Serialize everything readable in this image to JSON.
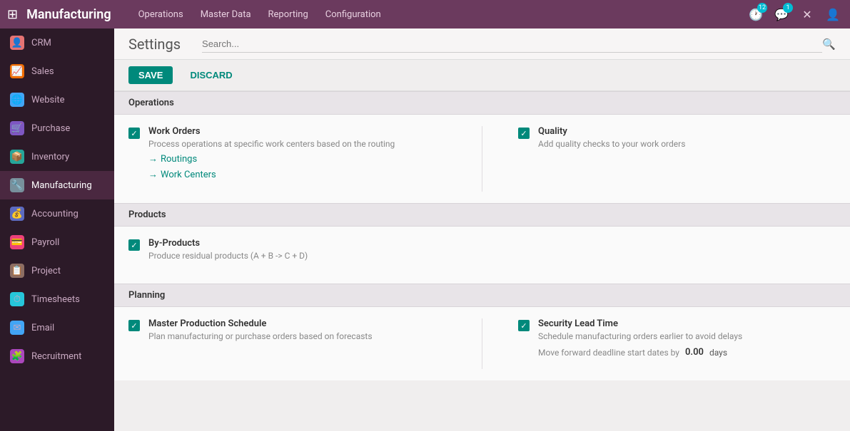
{
  "app": {
    "title": "Manufacturing",
    "nav_items": [
      "Operations",
      "Master Data",
      "Reporting",
      "Configuration"
    ],
    "badge_clock": "12",
    "badge_chat": "1"
  },
  "sidebar": {
    "items": [
      {
        "id": "crm",
        "label": "CRM",
        "icon": "👤",
        "icon_class": "icon-crm"
      },
      {
        "id": "sales",
        "label": "Sales",
        "icon": "📈",
        "icon_class": "icon-sales"
      },
      {
        "id": "website",
        "label": "Website",
        "icon": "🌐",
        "icon_class": "icon-website"
      },
      {
        "id": "purchase",
        "label": "Purchase",
        "icon": "🛒",
        "icon_class": "icon-purchase"
      },
      {
        "id": "inventory",
        "label": "Inventory",
        "icon": "📦",
        "icon_class": "icon-inventory"
      },
      {
        "id": "manufacturing",
        "label": "Manufacturing",
        "icon": "🔧",
        "icon_class": "icon-manufacturing",
        "active": true
      },
      {
        "id": "accounting",
        "label": "Accounting",
        "icon": "💰",
        "icon_class": "icon-accounting"
      },
      {
        "id": "payroll",
        "label": "Payroll",
        "icon": "💳",
        "icon_class": "icon-payroll"
      },
      {
        "id": "project",
        "label": "Project",
        "icon": "📋",
        "icon_class": "icon-project"
      },
      {
        "id": "timesheets",
        "label": "Timesheets",
        "icon": "⏱",
        "icon_class": "icon-timesheets"
      },
      {
        "id": "email",
        "label": "Email",
        "icon": "✉",
        "icon_class": "icon-email"
      },
      {
        "id": "recruitment",
        "label": "Recruitment",
        "icon": "🧩",
        "icon_class": "icon-recruitment"
      }
    ]
  },
  "toolbar": {
    "save_label": "SAVE",
    "discard_label": "DISCARD"
  },
  "settings": {
    "title": "Settings",
    "search_placeholder": "Search..."
  },
  "sections": {
    "operations": {
      "label": "Operations",
      "features": {
        "left": {
          "title": "Work Orders",
          "description": "Process operations at specific work centers based on the routing",
          "checked": true,
          "links": [
            "Routings",
            "Work Centers"
          ]
        },
        "right": {
          "title": "Quality",
          "description": "Add quality checks to your work orders",
          "checked": true
        }
      }
    },
    "products": {
      "label": "Products",
      "features": {
        "left": {
          "title": "By-Products",
          "description": "Produce residual products (A + B -> C + D)",
          "checked": true
        }
      }
    },
    "planning": {
      "label": "Planning",
      "features": {
        "left": {
          "title": "Master Production Schedule",
          "description": "Plan manufacturing or purchase orders based on forecasts",
          "checked": true
        },
        "right": {
          "title": "Security Lead Time",
          "description": "Schedule manufacturing orders earlier to avoid delays",
          "checked": true,
          "extra_label": "Move forward deadline start dates by",
          "extra_value": "0.00",
          "extra_unit": "days"
        }
      }
    }
  }
}
